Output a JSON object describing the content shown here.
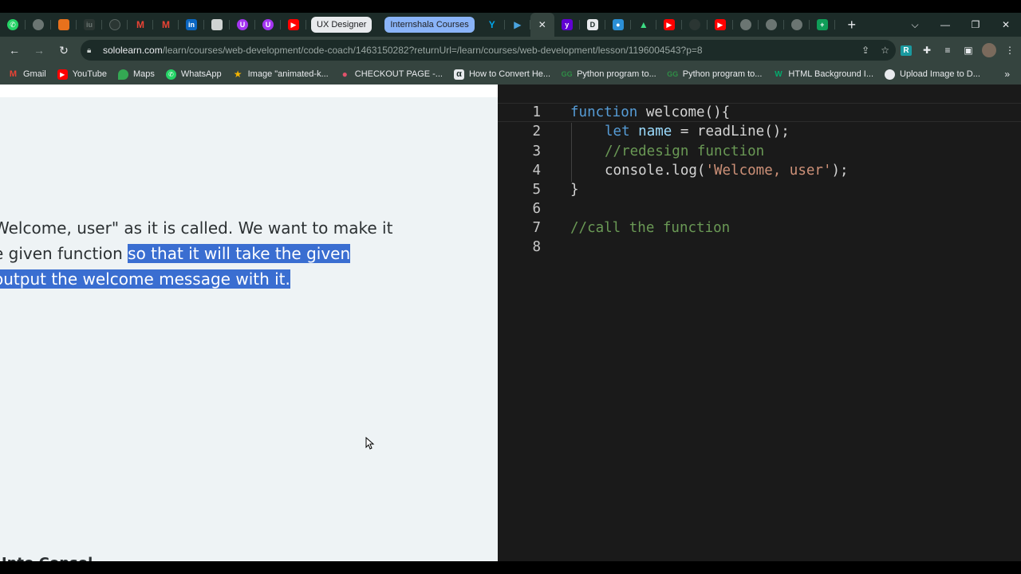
{
  "browser": {
    "tab_groups": {
      "ux_designer": "UX Designer",
      "internshala": "Internshala Courses"
    },
    "active_tab_close": "✕",
    "new_tab": "+",
    "window_controls": {
      "chevron": "⌵",
      "minimize": "—",
      "restore": "❐",
      "close": "✕"
    },
    "url_domain": "sololearn.com",
    "url_path": "/learn/courses/web-development/code-coach/1463150282?returnUrl=/learn/courses/web-development/lesson/1196004543?p=8",
    "bookmarks": [
      "Gmail",
      "YouTube",
      "Maps",
      "WhatsApp",
      "Image \"animated-k...",
      "CHECKOUT PAGE -...",
      "How to Convert He...",
      "Python program to...",
      "Python program to...",
      "HTML Background I...",
      "Upload Image to D..."
    ],
    "bookmarks_more": "»"
  },
  "problem": {
    "line1_plain": "Welcome, user\" as it is called. We want to make it",
    "line2_plain": "e given function ",
    "line2_highlight": "so that it will take the given",
    "line3_highlight": " output the welcome message with it.",
    "bottom_heading": "Unto Consol"
  },
  "editor": {
    "line_numbers": [
      "1",
      "2",
      "3",
      "4",
      "5",
      "6",
      "7",
      "8"
    ],
    "l1_kw": "function",
    "l1_rest": " welcome(){",
    "l2_kw": "let",
    "l2_var": "name",
    "l2_rest": " = readLine();",
    "l3_comment": "//redesign function",
    "l4_call": "console.log(",
    "l4_str": "'Welcome, user'",
    "l4_end": ");",
    "l5": "}",
    "l7_comment": "//call the function"
  }
}
